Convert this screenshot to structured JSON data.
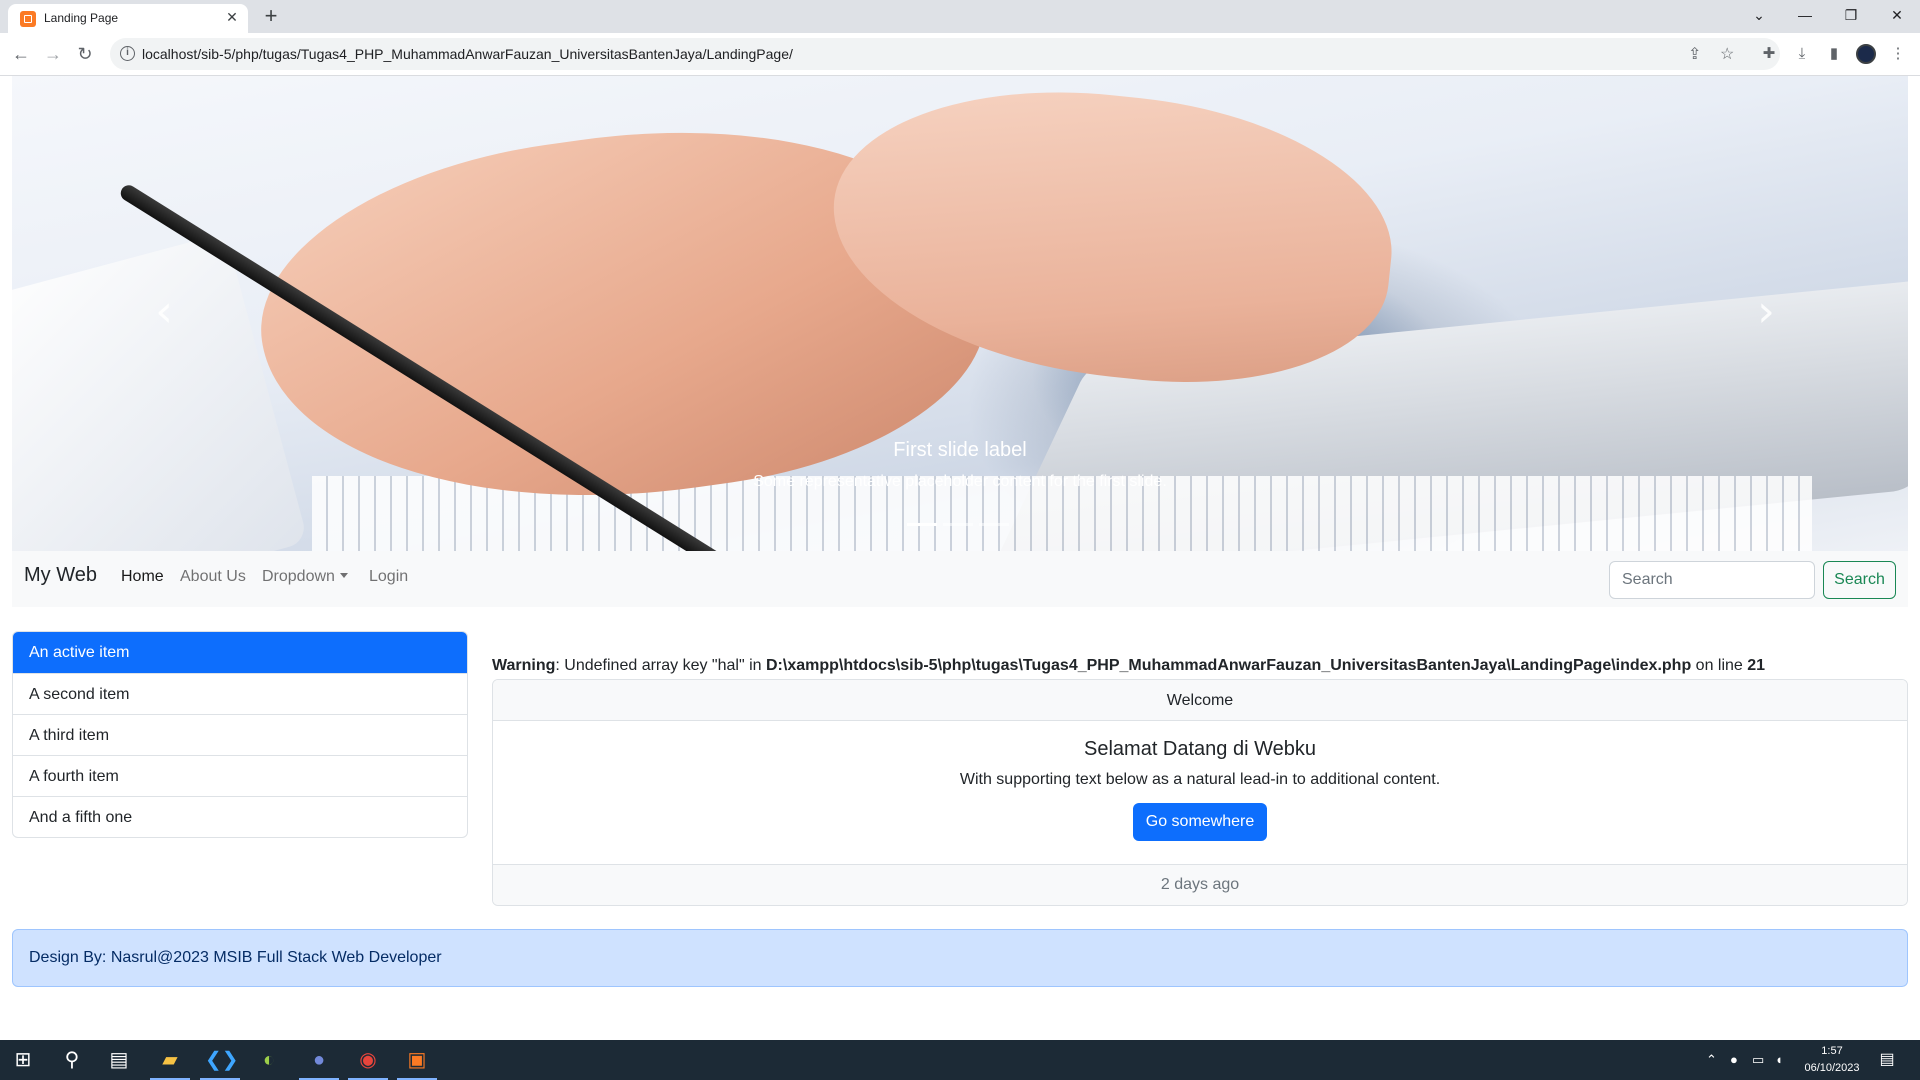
{
  "browser": {
    "tab_title": "Landing Page",
    "url": "localhost/sib-5/php/tugas/Tugas4_PHP_MuhammadAnwarFauzan_UniversitasBantenJaya/LandingPage/"
  },
  "carousel": {
    "caption_title": "First slide label",
    "caption_text": "Some representative placeholder content for the first slide.",
    "prev_icon": "chevron-left-icon",
    "next_icon": "chevron-right-icon"
  },
  "navbar": {
    "brand": "My Web",
    "links": [
      "Home",
      "About Us",
      "Dropdown",
      "Login"
    ],
    "active_link": "Home",
    "search_placeholder": "Search",
    "search_button": "Search"
  },
  "list_group": {
    "items": [
      "An active item",
      "A second item",
      "A third item",
      "A fourth item",
      "And a fifth one"
    ],
    "active_index": 0
  },
  "warning": {
    "label": "Warning",
    "message": ": Undefined array key \"hal\" in ",
    "path": "D:\\xampp\\htdocs\\sib-5\\php\\tugas\\Tugas4_PHP_MuhammadAnwarFauzan_UniversitasBantenJaya\\LandingPage\\index.php",
    "on_line": " on line ",
    "line": "21"
  },
  "card": {
    "header": "Welcome",
    "title": "Selamat Datang di Webku",
    "text": "With supporting text below as a natural lead-in to additional content.",
    "button": "Go somewhere",
    "footer": "2 days ago"
  },
  "footer": {
    "text": "Design By: Nasrul@2023 MSIB Full Stack Web Developer"
  },
  "taskbar": {
    "time": "1:57",
    "date": "06/10/2023"
  },
  "colors": {
    "primary": "#0d6efd",
    "success": "#198754",
    "alert_bg": "#cfe2ff",
    "navbar_bg": "#f8f9fa"
  }
}
